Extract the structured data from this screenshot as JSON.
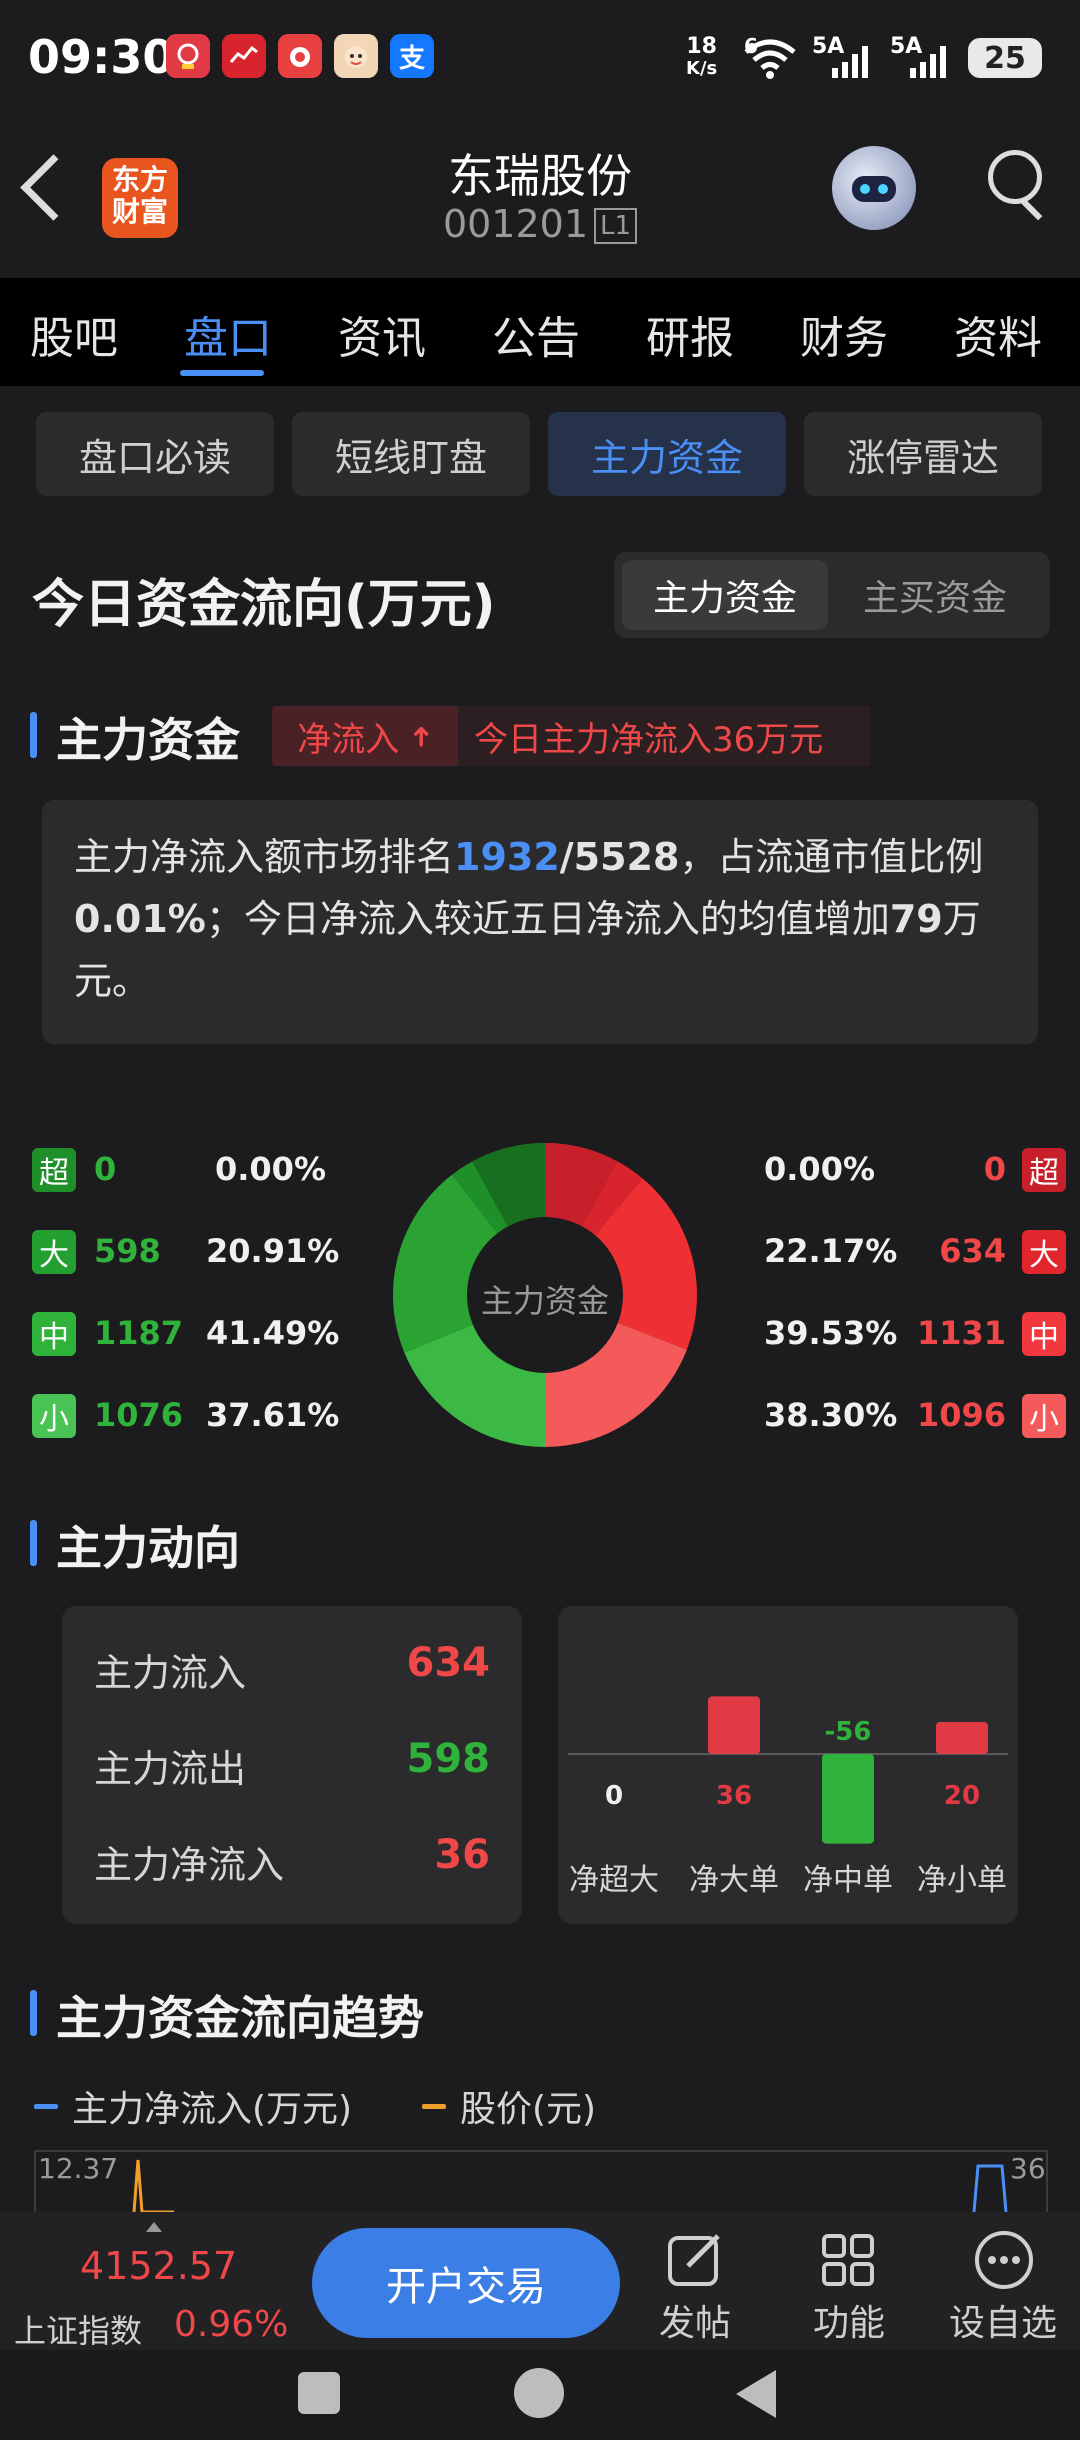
{
  "status": {
    "time": "09:30",
    "speed_top": "18",
    "speed_unit": "K/s",
    "net1": "6",
    "net2": "5A",
    "net3": "5A",
    "battery": "25",
    "app_icons": [
      "618-shopping-icon",
      "stock-chart-icon",
      "camera-app-icon",
      "kid-app-icon",
      "alipay-icon"
    ],
    "alipay_glyph": "支"
  },
  "header": {
    "logo_line1": "东方",
    "logo_line2": "财富",
    "stock_name": "东瑞股份",
    "stock_code": "001201",
    "level_badge": "L1"
  },
  "nav": {
    "tabs": [
      "股吧",
      "盘口",
      "资讯",
      "公告",
      "研报",
      "财务",
      "资料"
    ],
    "active": "盘口"
  },
  "subtabs": {
    "items": [
      "盘口必读",
      "短线盯盘",
      "主力资金",
      "涨停雷达"
    ],
    "active": "主力资金"
  },
  "flow_section": {
    "title": "今日资金流向(万元)",
    "toggle_on": "主力资金",
    "toggle_off": "主买资金"
  },
  "main_capital": {
    "title": "主力资金",
    "badge": "净流入",
    "badge_arrow": "➜",
    "headline": "今日主力净流入36万元",
    "summary_pre": "主力净流入额市场排名",
    "rank": "1932",
    "total": "/5528",
    "summary_mid": "，占流通市值比例",
    "ratio": "0.01%",
    "summary_mid2": "；今日净流入较近五日净流入的均值增加",
    "increase": "79",
    "summary_end": "万元。"
  },
  "donut": {
    "center_label": "主力资金",
    "outflow": [
      {
        "tag": "超",
        "value": "0",
        "pct": "0.00%",
        "color": "#1f8f2a"
      },
      {
        "tag": "大",
        "value": "598",
        "pct": "20.91%",
        "color": "#23a02f"
      },
      {
        "tag": "中",
        "value": "1187",
        "pct": "41.49%",
        "color": "#2fb33a"
      },
      {
        "tag": "小",
        "value": "1076",
        "pct": "37.61%",
        "color": "#49c354"
      }
    ],
    "inflow": [
      {
        "tag": "超",
        "value": "0",
        "pct": "0.00%",
        "color": "#c8202a"
      },
      {
        "tag": "大",
        "value": "634",
        "pct": "22.17%",
        "color": "#e2262e"
      },
      {
        "tag": "中",
        "value": "1131",
        "pct": "39.53%",
        "color": "#f0383e"
      },
      {
        "tag": "小",
        "value": "1096",
        "pct": "38.30%",
        "color": "#f45a5a"
      }
    ]
  },
  "direction": {
    "title": "主力动向",
    "rows": [
      {
        "label": "主力流入",
        "value": "634",
        "color": "#f04848"
      },
      {
        "label": "主力流出",
        "value": "598",
        "color": "#2fb33a"
      },
      {
        "label": "主力净流入",
        "value": "36",
        "color": "#f04848"
      }
    ]
  },
  "chart_data": {
    "type": "bar",
    "categories": [
      "净超大",
      "净大单",
      "净中单",
      "净小单"
    ],
    "values": [
      0,
      36,
      -56,
      20
    ],
    "title": "",
    "xlabel": "",
    "ylabel": "",
    "colors": {
      "positive": "#e23a44",
      "negative": "#2fb33a"
    }
  },
  "trend": {
    "title": "主力资金流向趋势",
    "legend_net": "主力净流入(万元)",
    "legend_price": "股价(元)",
    "left_axis_top": "12.37",
    "right_axis_top": "36",
    "net_color": "#4a8ff5",
    "price_color": "#f0a02a"
  },
  "bottom": {
    "index_value": "4152.57",
    "index_name": "上证指数",
    "index_change": "0.96%",
    "cta": "开户交易",
    "actions": [
      {
        "icon": "edit-icon",
        "label": "发帖"
      },
      {
        "icon": "grid-icon",
        "label": "功能"
      },
      {
        "icon": "more-icon",
        "label": "设自选"
      }
    ]
  }
}
